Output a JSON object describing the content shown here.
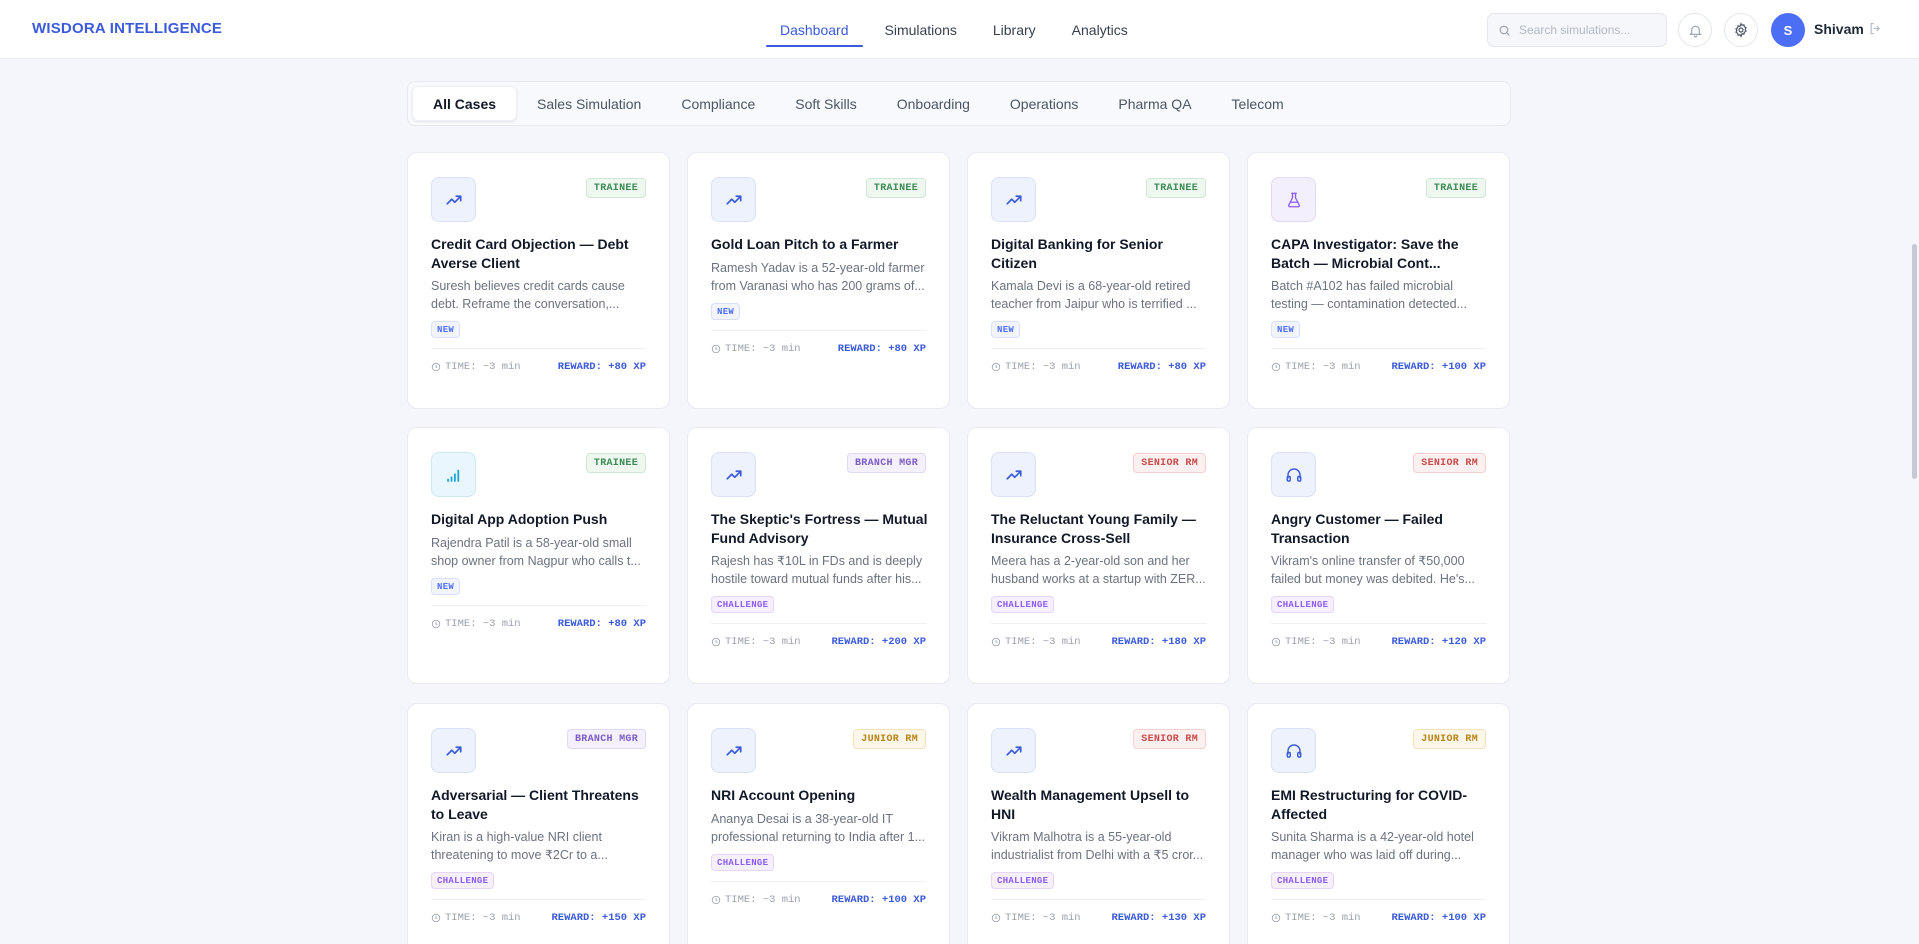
{
  "brand": "WISDORA INTELLIGENCE",
  "nav": [
    {
      "label": "Dashboard",
      "active": true
    },
    {
      "label": "Simulations",
      "active": false
    },
    {
      "label": "Library",
      "active": false
    },
    {
      "label": "Analytics",
      "active": false
    }
  ],
  "search": {
    "placeholder": "Search simulations..."
  },
  "user": {
    "initial": "S",
    "name": "Shivam"
  },
  "filters": [
    {
      "label": "All Cases",
      "active": true
    },
    {
      "label": "Sales Simulation"
    },
    {
      "label": "Compliance"
    },
    {
      "label": "Soft Skills"
    },
    {
      "label": "Onboarding"
    },
    {
      "label": "Operations"
    },
    {
      "label": "Pharma QA"
    },
    {
      "label": "Telecom"
    }
  ],
  "cards": [
    {
      "icon": "trend-up-icon",
      "level": "TRAINEE",
      "title": "Credit Card Objection — Debt Averse Client",
      "desc": "Suresh believes credit cards cause debt. Reframe the conversation,...",
      "tag": "NEW",
      "time": "TIME: ~3 min",
      "reward": "REWARD: +80 XP"
    },
    {
      "icon": "trend-up-icon",
      "level": "TRAINEE",
      "title": "Gold Loan Pitch to a Farmer",
      "desc": "Ramesh Yadav is a 52-year-old farmer from Varanasi who has 200 grams of...",
      "tag": "NEW",
      "time": "TIME: ~3 min",
      "reward": "REWARD: +80 XP"
    },
    {
      "icon": "trend-up-icon",
      "level": "TRAINEE",
      "title": "Digital Banking for Senior Citizen",
      "desc": "Kamala Devi is a 68-year-old retired teacher from Jaipur who is terrified ...",
      "tag": "NEW",
      "time": "TIME: ~3 min",
      "reward": "REWARD: +80 XP"
    },
    {
      "icon": "flask-icon",
      "level": "TRAINEE",
      "title": "CAPA Investigator: Save the Batch — Microbial Cont...",
      "desc": "Batch #A102 has failed microbial testing — contamination detected...",
      "tag": "NEW",
      "time": "TIME: ~3 min",
      "reward": "REWARD: +100 XP"
    },
    {
      "icon": "signal-icon",
      "level": "TRAINEE",
      "title": "Digital App Adoption Push",
      "desc": "Rajendra Patil is a 58-year-old small shop owner from Nagpur who calls t...",
      "tag": "NEW",
      "time": "TIME: ~3 min",
      "reward": "REWARD: +80 XP"
    },
    {
      "icon": "trend-up-icon",
      "level": "BRANCH MGR",
      "title": "The Skeptic's Fortress — Mutual Fund Advisory",
      "desc": "Rajesh has ₹10L in FDs and is deeply hostile toward mutual funds after his...",
      "tag": "CHALLENGE",
      "time": "TIME: ~3 min",
      "reward": "REWARD: +200 XP"
    },
    {
      "icon": "trend-up-icon",
      "level": "SENIOR RM",
      "title": "The Reluctant Young Family — Insurance Cross-Sell",
      "desc": "Meera has a 2-year-old son and her husband works at a startup with ZER...",
      "tag": "CHALLENGE",
      "time": "TIME: ~3 min",
      "reward": "REWARD: +180 XP"
    },
    {
      "icon": "headphones-icon",
      "level": "SENIOR RM",
      "title": "Angry Customer — Failed Transaction",
      "desc": "Vikram's online transfer of ₹50,000 failed but money was debited. He's...",
      "tag": "CHALLENGE",
      "time": "TIME: ~3 min",
      "reward": "REWARD: +120 XP"
    },
    {
      "icon": "trend-up-icon",
      "level": "BRANCH MGR",
      "title": "Adversarial — Client Threatens to Leave",
      "desc": "Kiran is a high-value NRI client threatening to move ₹2Cr to a...",
      "tag": "CHALLENGE",
      "time": "TIME: ~3 min",
      "reward": "REWARD: +150 XP"
    },
    {
      "icon": "trend-up-icon",
      "level": "JUNIOR RM",
      "title": "NRI Account Opening",
      "desc": "Ananya Desai is a 38-year-old IT professional returning to India after 1...",
      "tag": "CHALLENGE",
      "time": "TIME: ~3 min",
      "reward": "REWARD: +100 XP"
    },
    {
      "icon": "trend-up-icon",
      "level": "SENIOR RM",
      "title": "Wealth Management Upsell to HNI",
      "desc": "Vikram Malhotra is a 55-year-old industrialist from Delhi with a ₹5 cror...",
      "tag": "CHALLENGE",
      "time": "TIME: ~3 min",
      "reward": "REWARD: +130 XP"
    },
    {
      "icon": "headphones-icon",
      "level": "JUNIOR RM",
      "title": "EMI Restructuring for COVID-Affected",
      "desc": "Sunita Sharma is a 42-year-old hotel manager who was laid off during...",
      "tag": "CHALLENGE",
      "time": "TIME: ~3 min",
      "reward": "REWARD: +100 XP"
    }
  ]
}
